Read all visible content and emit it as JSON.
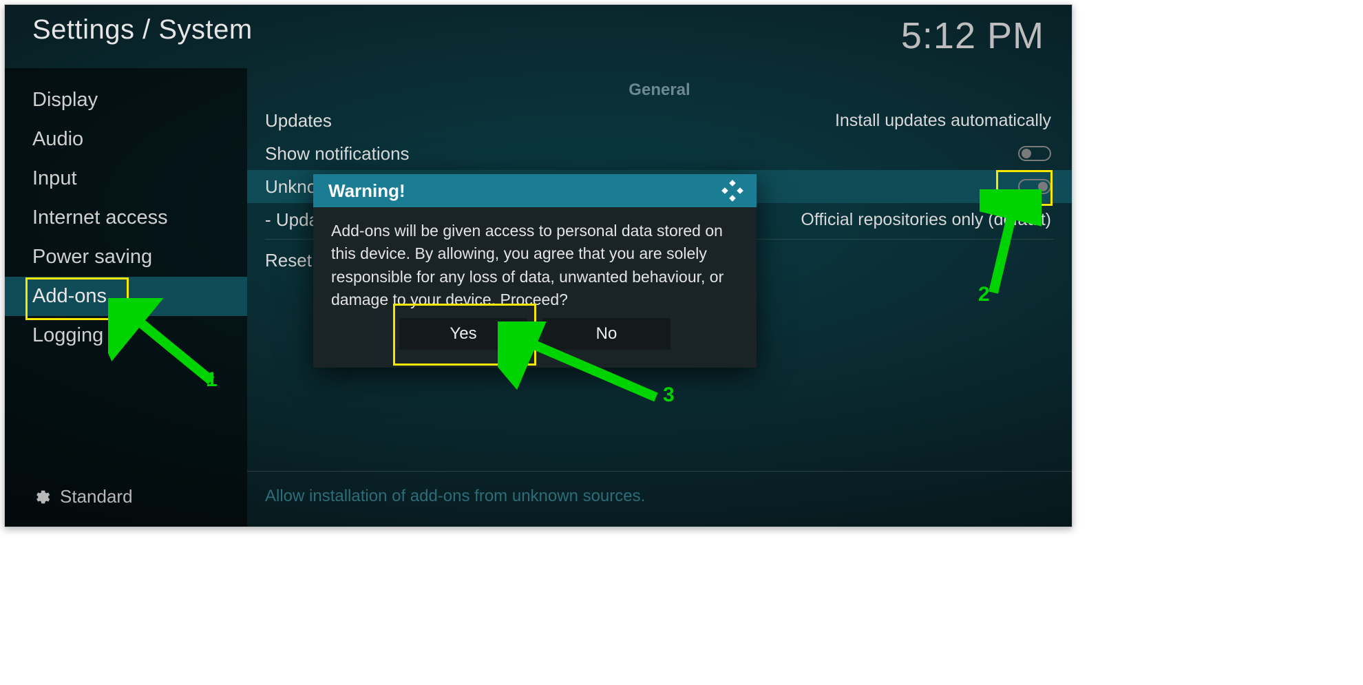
{
  "header": {
    "breadcrumb": "Settings / System",
    "clock": "5:12 PM"
  },
  "sidebar": {
    "items": [
      {
        "label": "Display"
      },
      {
        "label": "Audio"
      },
      {
        "label": "Input"
      },
      {
        "label": "Internet access"
      },
      {
        "label": "Power saving"
      },
      {
        "label": "Add-ons"
      },
      {
        "label": "Logging"
      }
    ],
    "selected_index": 5,
    "level_label": "Standard"
  },
  "content": {
    "section_header": "General",
    "rows": {
      "updates": {
        "label": "Updates",
        "value": "Install updates automatically"
      },
      "show_notifications": {
        "label": "Show notifications",
        "toggle": "off"
      },
      "unknown_sources": {
        "label": "Unknown sources",
        "toggle": "on"
      },
      "update_repos": {
        "label": "- Update official add-ons from",
        "value": "Official repositories only (default)"
      },
      "reset": {
        "label": "Reset above settings to default"
      }
    },
    "help_text": "Allow installation of add-ons from unknown sources."
  },
  "dialog": {
    "title": "Warning!",
    "message": "Add-ons will be given access to personal data stored on this device. By allowing, you agree that you are solely responsible for any loss of data, unwanted behaviour, or damage to your device. Proceed?",
    "yes_label": "Yes",
    "no_label": "No"
  },
  "annotations": {
    "n1": "1",
    "n2": "2",
    "n3": "3"
  }
}
